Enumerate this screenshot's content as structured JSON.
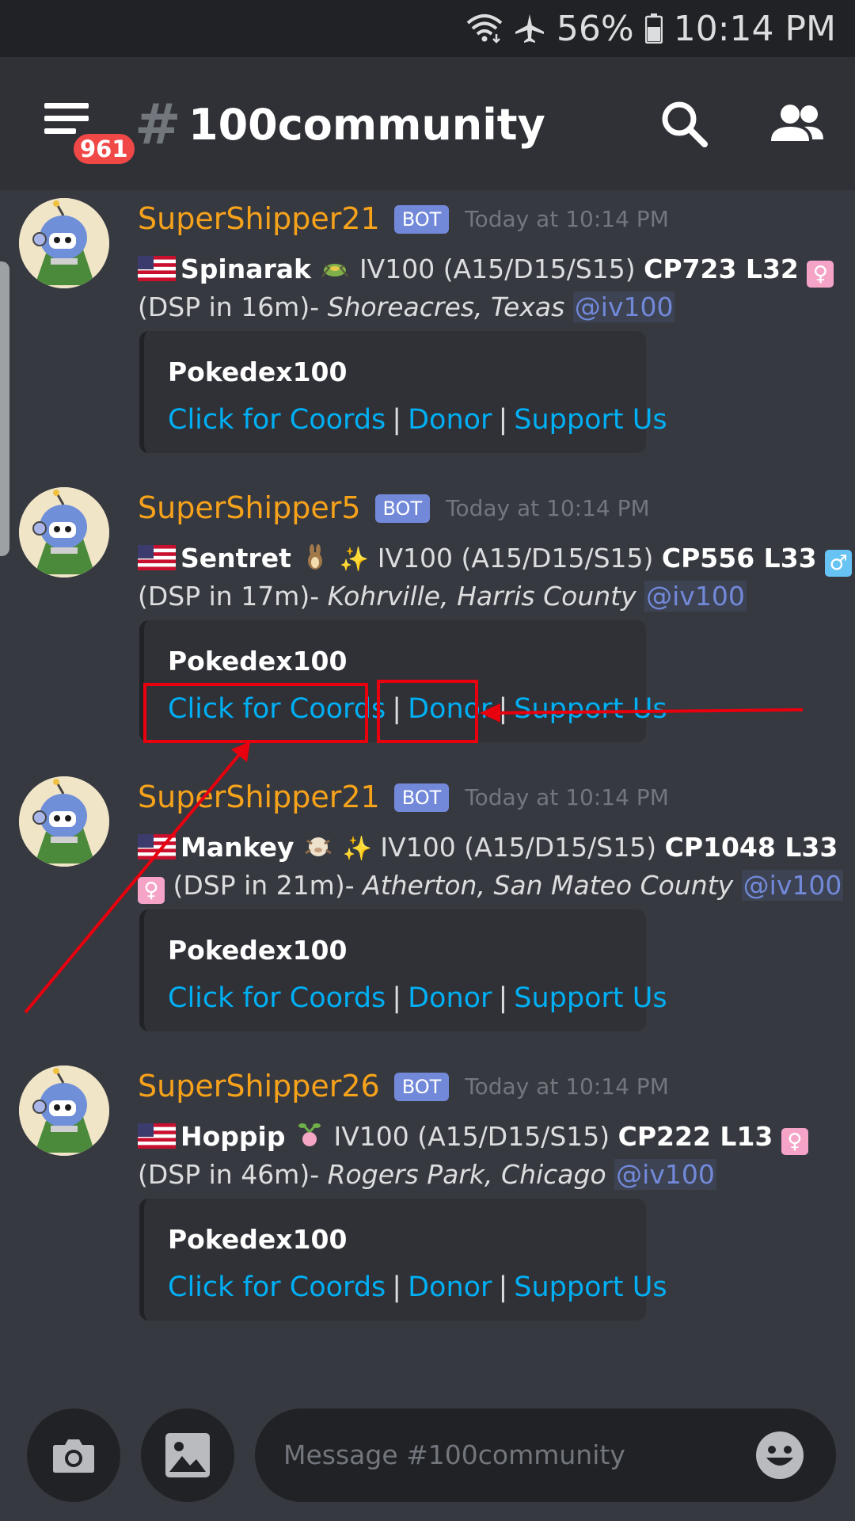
{
  "status_bar": {
    "battery": "56%",
    "time": "10:14 PM"
  },
  "header": {
    "badge_count": "961",
    "hash": "#",
    "channel_name": "100community"
  },
  "messages": [
    {
      "username": "SuperShipper21",
      "bot_tag": "BOT",
      "timestamp": "Today at 10:14 PM",
      "pokemon": "Spinarak",
      "stats": "IV100 (A15/D15/S15)",
      "cp_level": "CP723 L32",
      "gender": "♀",
      "despawn": "(DSP in 16m)-",
      "location": "Shoreacres, Texas",
      "mention": "@iv100",
      "embed": {
        "title": "Pokedex100",
        "link1": "Click for Coords",
        "link2": "Donor",
        "link3": "Support Us",
        "sep": "|"
      }
    },
    {
      "username": "SuperShipper5",
      "bot_tag": "BOT",
      "timestamp": "Today at 10:14 PM",
      "pokemon": "Sentret",
      "sparkle": "✨",
      "stats": "IV100 (A15/D15/S15)",
      "cp_level": "CP556 L33",
      "gender": "♂",
      "despawn": "(DSP in 17m)-",
      "location": "Kohrville, Harris County",
      "mention": "@iv100",
      "embed": {
        "title": "Pokedex100",
        "link1": "Click for Coords",
        "link2": "Donor",
        "link3": "Support Us",
        "sep": "|"
      }
    },
    {
      "username": "SuperShipper21",
      "bot_tag": "BOT",
      "timestamp": "Today at 10:14 PM",
      "pokemon": "Mankey",
      "sparkle": "✨",
      "stats": "IV100 (A15/D15/S15)",
      "cp_level": "CP1048 L33",
      "gender": "♀",
      "despawn": "(DSP in 21m)-",
      "location": "Atherton, San Mateo County",
      "mention": "@iv100",
      "embed": {
        "title": "Pokedex100",
        "link1": "Click for Coords",
        "link2": "Donor",
        "link3": "Support Us",
        "sep": "|"
      }
    },
    {
      "username": "SuperShipper26",
      "bot_tag": "BOT",
      "timestamp": "Today at 10:14 PM",
      "pokemon": "Hoppip",
      "stats": "IV100 (A15/D15/S15)",
      "cp_level": "CP222 L13",
      "gender": "♀",
      "despawn": "(DSP in 46m)-",
      "location": "Rogers Park, Chicago",
      "mention": "@iv100",
      "embed": {
        "title": "Pokedex100",
        "link1": "Click for Coords",
        "link2": "Donor",
        "link3": "Support Us",
        "sep": "|"
      }
    }
  ],
  "input": {
    "placeholder": "Message #100community"
  },
  "icons": {
    "status": [
      "wifi-icon",
      "airplane-icon",
      "battery-icon"
    ],
    "header": [
      "menu-icon",
      "search-icon",
      "members-icon"
    ],
    "input": [
      "camera-icon",
      "image-icon",
      "emoji-icon"
    ]
  },
  "colors": {
    "background": "#36393f",
    "header": "#2f3136",
    "username": "#f7a21b",
    "link": "#00aff4",
    "mention": "#7289da",
    "annotation": "#e8000e",
    "badge": "#f04747"
  }
}
